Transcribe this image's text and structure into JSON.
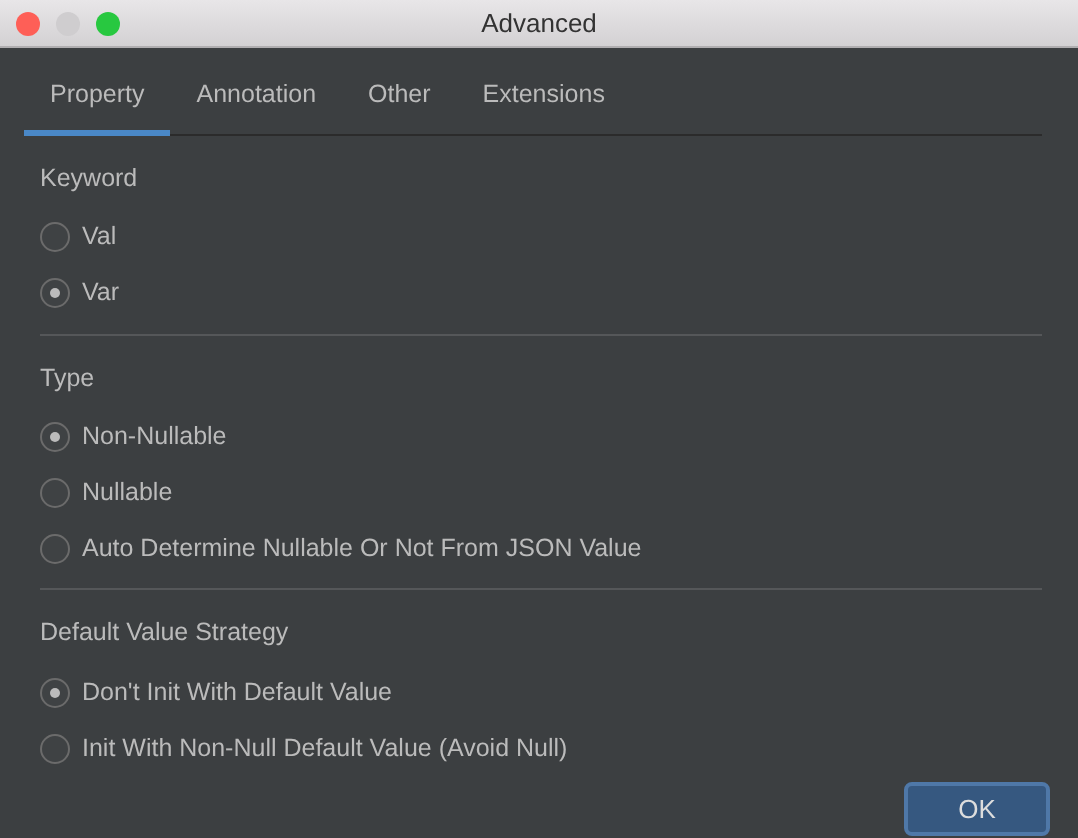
{
  "window": {
    "title": "Advanced"
  },
  "tabs": [
    {
      "label": "Property",
      "selected": true
    },
    {
      "label": "Annotation",
      "selected": false
    },
    {
      "label": "Other",
      "selected": false
    },
    {
      "label": "Extensions",
      "selected": false
    }
  ],
  "sections": [
    {
      "title": "Keyword",
      "options": [
        {
          "label": "Val",
          "selected": false
        },
        {
          "label": "Var",
          "selected": true
        }
      ]
    },
    {
      "title": "Type",
      "options": [
        {
          "label": "Non-Nullable",
          "selected": true
        },
        {
          "label": "Nullable",
          "selected": false
        },
        {
          "label": "Auto Determine Nullable Or Not From JSON Value",
          "selected": false
        }
      ]
    },
    {
      "title": "Default Value Strategy",
      "options": [
        {
          "label": "Don't Init With Default Value",
          "selected": true
        },
        {
          "label": "Init With Non-Null Default Value (Avoid Null)",
          "selected": false
        }
      ]
    }
  ],
  "buttons": [
    "OK"
  ]
}
